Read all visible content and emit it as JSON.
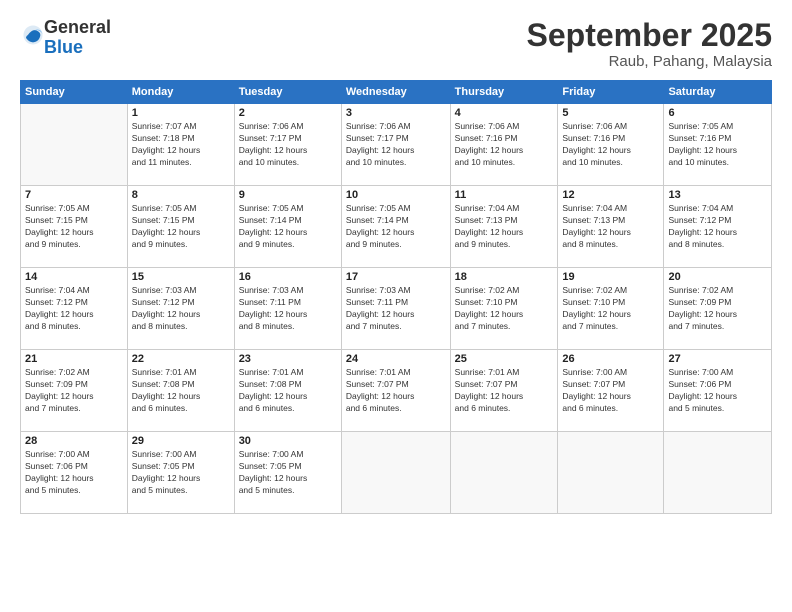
{
  "logo": {
    "general": "General",
    "blue": "Blue"
  },
  "title": "September 2025",
  "location": "Raub, Pahang, Malaysia",
  "weekdays": [
    "Sunday",
    "Monday",
    "Tuesday",
    "Wednesday",
    "Thursday",
    "Friday",
    "Saturday"
  ],
  "weeks": [
    [
      {
        "day": "",
        "info": ""
      },
      {
        "day": "1",
        "info": "Sunrise: 7:07 AM\nSunset: 7:18 PM\nDaylight: 12 hours\nand 11 minutes."
      },
      {
        "day": "2",
        "info": "Sunrise: 7:06 AM\nSunset: 7:17 PM\nDaylight: 12 hours\nand 10 minutes."
      },
      {
        "day": "3",
        "info": "Sunrise: 7:06 AM\nSunset: 7:17 PM\nDaylight: 12 hours\nand 10 minutes."
      },
      {
        "day": "4",
        "info": "Sunrise: 7:06 AM\nSunset: 7:16 PM\nDaylight: 12 hours\nand 10 minutes."
      },
      {
        "day": "5",
        "info": "Sunrise: 7:06 AM\nSunset: 7:16 PM\nDaylight: 12 hours\nand 10 minutes."
      },
      {
        "day": "6",
        "info": "Sunrise: 7:05 AM\nSunset: 7:16 PM\nDaylight: 12 hours\nand 10 minutes."
      }
    ],
    [
      {
        "day": "7",
        "info": "Sunrise: 7:05 AM\nSunset: 7:15 PM\nDaylight: 12 hours\nand 9 minutes."
      },
      {
        "day": "8",
        "info": "Sunrise: 7:05 AM\nSunset: 7:15 PM\nDaylight: 12 hours\nand 9 minutes."
      },
      {
        "day": "9",
        "info": "Sunrise: 7:05 AM\nSunset: 7:14 PM\nDaylight: 12 hours\nand 9 minutes."
      },
      {
        "day": "10",
        "info": "Sunrise: 7:05 AM\nSunset: 7:14 PM\nDaylight: 12 hours\nand 9 minutes."
      },
      {
        "day": "11",
        "info": "Sunrise: 7:04 AM\nSunset: 7:13 PM\nDaylight: 12 hours\nand 9 minutes."
      },
      {
        "day": "12",
        "info": "Sunrise: 7:04 AM\nSunset: 7:13 PM\nDaylight: 12 hours\nand 8 minutes."
      },
      {
        "day": "13",
        "info": "Sunrise: 7:04 AM\nSunset: 7:12 PM\nDaylight: 12 hours\nand 8 minutes."
      }
    ],
    [
      {
        "day": "14",
        "info": "Sunrise: 7:04 AM\nSunset: 7:12 PM\nDaylight: 12 hours\nand 8 minutes."
      },
      {
        "day": "15",
        "info": "Sunrise: 7:03 AM\nSunset: 7:12 PM\nDaylight: 12 hours\nand 8 minutes."
      },
      {
        "day": "16",
        "info": "Sunrise: 7:03 AM\nSunset: 7:11 PM\nDaylight: 12 hours\nand 8 minutes."
      },
      {
        "day": "17",
        "info": "Sunrise: 7:03 AM\nSunset: 7:11 PM\nDaylight: 12 hours\nand 7 minutes."
      },
      {
        "day": "18",
        "info": "Sunrise: 7:02 AM\nSunset: 7:10 PM\nDaylight: 12 hours\nand 7 minutes."
      },
      {
        "day": "19",
        "info": "Sunrise: 7:02 AM\nSunset: 7:10 PM\nDaylight: 12 hours\nand 7 minutes."
      },
      {
        "day": "20",
        "info": "Sunrise: 7:02 AM\nSunset: 7:09 PM\nDaylight: 12 hours\nand 7 minutes."
      }
    ],
    [
      {
        "day": "21",
        "info": "Sunrise: 7:02 AM\nSunset: 7:09 PM\nDaylight: 12 hours\nand 7 minutes."
      },
      {
        "day": "22",
        "info": "Sunrise: 7:01 AM\nSunset: 7:08 PM\nDaylight: 12 hours\nand 6 minutes."
      },
      {
        "day": "23",
        "info": "Sunrise: 7:01 AM\nSunset: 7:08 PM\nDaylight: 12 hours\nand 6 minutes."
      },
      {
        "day": "24",
        "info": "Sunrise: 7:01 AM\nSunset: 7:07 PM\nDaylight: 12 hours\nand 6 minutes."
      },
      {
        "day": "25",
        "info": "Sunrise: 7:01 AM\nSunset: 7:07 PM\nDaylight: 12 hours\nand 6 minutes."
      },
      {
        "day": "26",
        "info": "Sunrise: 7:00 AM\nSunset: 7:07 PM\nDaylight: 12 hours\nand 6 minutes."
      },
      {
        "day": "27",
        "info": "Sunrise: 7:00 AM\nSunset: 7:06 PM\nDaylight: 12 hours\nand 5 minutes."
      }
    ],
    [
      {
        "day": "28",
        "info": "Sunrise: 7:00 AM\nSunset: 7:06 PM\nDaylight: 12 hours\nand 5 minutes."
      },
      {
        "day": "29",
        "info": "Sunrise: 7:00 AM\nSunset: 7:05 PM\nDaylight: 12 hours\nand 5 minutes."
      },
      {
        "day": "30",
        "info": "Sunrise: 7:00 AM\nSunset: 7:05 PM\nDaylight: 12 hours\nand 5 minutes."
      },
      {
        "day": "",
        "info": ""
      },
      {
        "day": "",
        "info": ""
      },
      {
        "day": "",
        "info": ""
      },
      {
        "day": "",
        "info": ""
      }
    ]
  ]
}
